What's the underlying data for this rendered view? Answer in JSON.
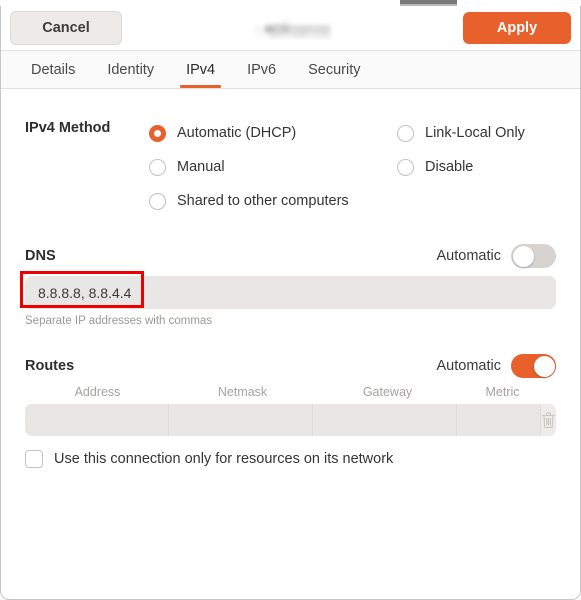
{
  "window": {
    "title_redacted": true
  },
  "header": {
    "cancel_label": "Cancel",
    "apply_label": "Apply",
    "accent_color": "#e8602c"
  },
  "tabs": [
    {
      "label": "Details",
      "active": false
    },
    {
      "label": "Identity",
      "active": false
    },
    {
      "label": "IPv4",
      "active": true
    },
    {
      "label": "IPv6",
      "active": false
    },
    {
      "label": "Security",
      "active": false
    }
  ],
  "ipv4_method": {
    "label": "IPv4 Method",
    "options_left": [
      {
        "label": "Automatic (DHCP)",
        "checked": true
      },
      {
        "label": "Manual",
        "checked": false
      },
      {
        "label": "Shared to other computers",
        "checked": false
      }
    ],
    "options_right": [
      {
        "label": "Link-Local Only",
        "checked": false
      },
      {
        "label": "Disable",
        "checked": false
      }
    ]
  },
  "dns": {
    "label": "DNS",
    "automatic_label": "Automatic",
    "automatic_on": false,
    "value": "8.8.8.8, 8.8.4.4",
    "hint": "Separate IP addresses with commas"
  },
  "routes": {
    "label": "Routes",
    "automatic_label": "Automatic",
    "automatic_on": true,
    "columns": [
      "Address",
      "Netmask",
      "Gateway",
      "Metric"
    ],
    "rows": [
      {
        "address": "",
        "netmask": "",
        "gateway": "",
        "metric": ""
      }
    ],
    "delete_icon": "trash-icon"
  },
  "network_only": {
    "label": "Use this connection only for resources on its network",
    "checked": false
  },
  "annotation": {
    "color": "#ee0000",
    "target": "dns-value-field"
  }
}
